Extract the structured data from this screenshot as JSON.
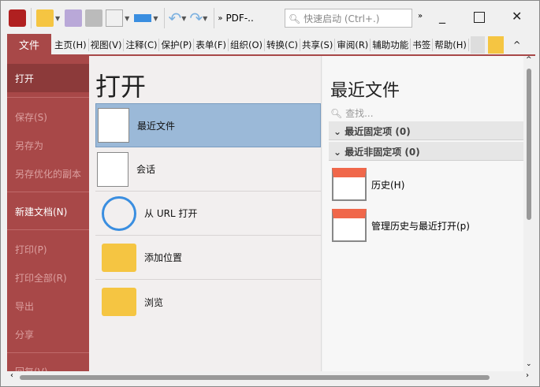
{
  "toolbar": {
    "pdf_label": "PDF-..",
    "search_placeholder": "快速启动 (Ctrl+.)"
  },
  "tabs": [
    "主页(H)",
    "视图(V)",
    "注释(C)",
    "保护(P)",
    "表单(F)",
    "组织(O)",
    "转换(C)",
    "共享(S)",
    "审阅(R)",
    "辅助功能",
    "书签",
    "帮助(H)"
  ],
  "file_tab": "文件",
  "sidebar": {
    "items": [
      "打开",
      "保存(S)",
      "另存为",
      "另存优化的副本",
      "新建文档(N)",
      "打印(P)",
      "打印全部(R)",
      "导出",
      "分享",
      "回复(V)"
    ]
  },
  "middle": {
    "title": "打开",
    "items": [
      "最近文件",
      "会话",
      "从 URL 打开",
      "添加位置",
      "浏览"
    ]
  },
  "right": {
    "title": "最近文件",
    "search_placeholder": "查找...",
    "groups": [
      "最近固定项 (0)",
      "最近非固定项 (0)"
    ],
    "items": [
      "历史(H)",
      "管理历史与最近打开(p)"
    ]
  },
  "colors": {
    "accent": "#a84848",
    "selected": "#9bb9d8"
  }
}
